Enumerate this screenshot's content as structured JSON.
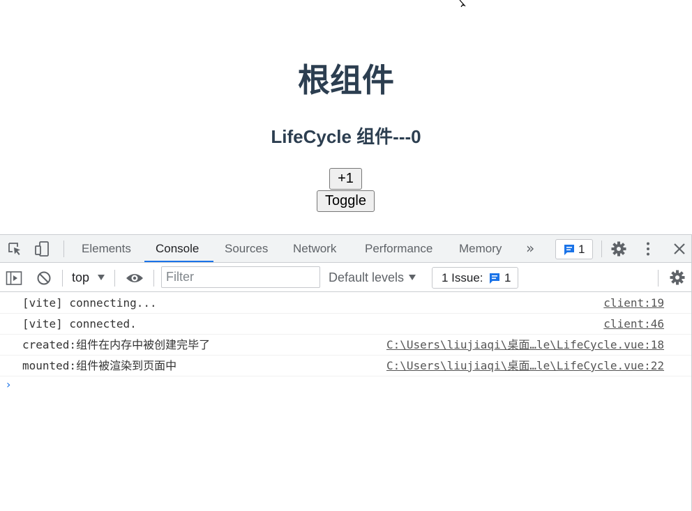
{
  "app": {
    "title": "根组件",
    "subtitle": "LifeCycle 组件---0",
    "increment_button": "+1",
    "toggle_button": "Toggle"
  },
  "devtools": {
    "tabs": [
      {
        "label": "Elements",
        "active": false
      },
      {
        "label": "Console",
        "active": true
      },
      {
        "label": "Sources",
        "active": false
      },
      {
        "label": "Network",
        "active": false
      },
      {
        "label": "Performance",
        "active": false
      },
      {
        "label": "Memory",
        "active": false
      }
    ],
    "more_tabs": "»",
    "messages_count": "1",
    "toolbar": {
      "context": "top",
      "filter_placeholder": "Filter",
      "levels": "Default levels",
      "issues_label": "1 Issue:",
      "issues_count": "1"
    },
    "logs": [
      {
        "text": "[vite] connecting...",
        "source": "client:19"
      },
      {
        "text": "[vite] connected.",
        "source": "client:46"
      },
      {
        "text": "created:组件在内存中被创建完毕了",
        "source": "C:\\Users\\liujiaqi\\桌面…le\\LifeCycle.vue:18"
      },
      {
        "text": "mounted:组件被渲染到页面中",
        "source": "C:\\Users\\liujiaqi\\桌面…le\\LifeCycle.vue:22"
      }
    ],
    "prompt_symbol": "›"
  },
  "colors": {
    "heading": "#2c3e50",
    "accent": "#1a73e8",
    "toolbar_bg": "#f1f3f4"
  },
  "icons": [
    "inspect-element-icon",
    "device-toolbar-icon",
    "message-icon",
    "settings-gear-icon",
    "kebab-menu-icon",
    "close-icon",
    "sidebar-toggle-icon",
    "clear-console-icon",
    "dropdown-arrow-icon",
    "live-expression-eye-icon",
    "issue-icon"
  ]
}
